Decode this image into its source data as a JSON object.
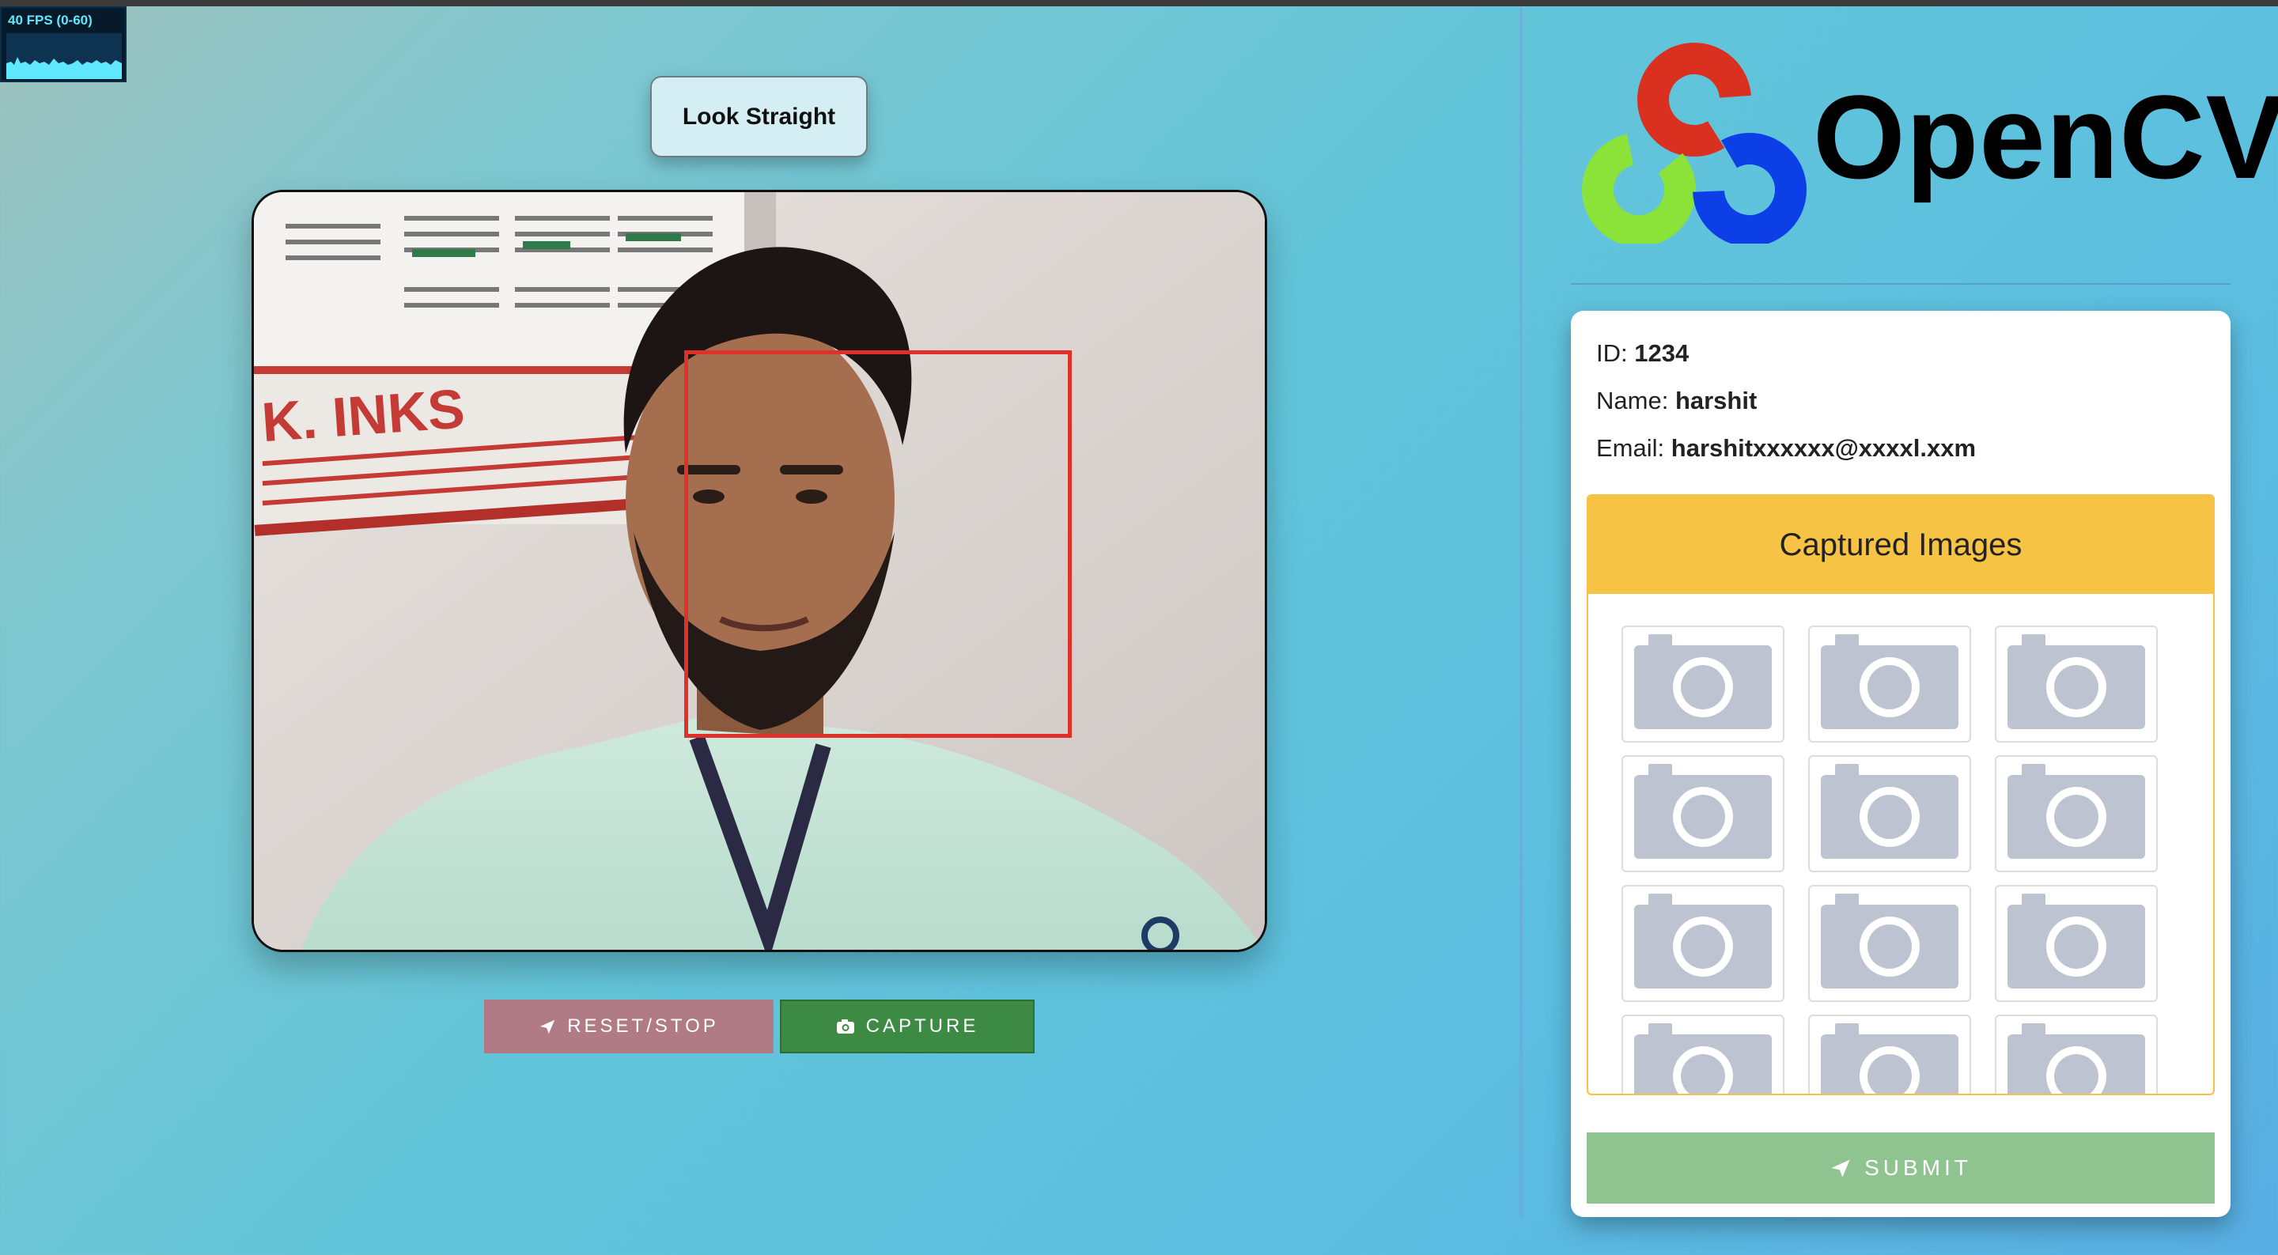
{
  "fps": {
    "label": "40 FPS (0-60)"
  },
  "prompt": {
    "text": "Look Straight"
  },
  "video": {
    "icon": "webcam-feed"
  },
  "buttons": {
    "reset_label": "RESET/STOP",
    "reset_icon": "paper-plane-icon",
    "capture_label": "CAPTURE",
    "capture_icon": "camera-icon"
  },
  "logo": {
    "text": "OpenCV",
    "colors": [
      "#d9301f",
      "#8be33a",
      "#0d3fe6"
    ]
  },
  "user": {
    "id_label": "ID:",
    "id": "1234",
    "name_label": "Name:",
    "name": "harshit",
    "email_label": "Email:",
    "email": "harshitxxxxxx@xxxxl.xxm"
  },
  "gallery": {
    "title": "Captured Images",
    "thumbnail_icon": "camera-placeholder-icon",
    "count_visible": 12
  },
  "submit": {
    "label": "SUBMIT",
    "icon": "paper-plane-icon",
    "color": "#8fc38f"
  },
  "colors": {
    "accent_yellow": "#f7c344",
    "reset": "#b17b86",
    "capture": "#3d8a45",
    "face_box": "#e0302a"
  }
}
